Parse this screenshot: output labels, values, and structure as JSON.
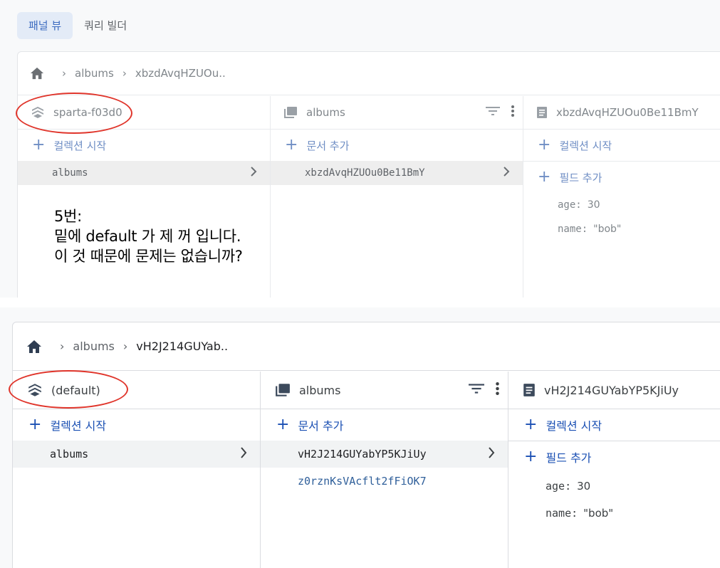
{
  "top": {
    "tabs": [
      {
        "label": "패널 뷰",
        "active": true
      },
      {
        "label": "쿼리 빌더",
        "active": false
      }
    ],
    "breadcrumb": {
      "root_icon": "home-icon",
      "items": [
        "albums",
        "xbzdAvqHZUOu.."
      ]
    },
    "columns": {
      "database": {
        "title": "sparta-f03d0",
        "action": "컬렉션 시작",
        "items": [
          "albums"
        ]
      },
      "collection": {
        "title": "albums",
        "action": "문서 추가",
        "items": [
          "xbzdAvqHZUOu0Be11BmY"
        ]
      },
      "document": {
        "title": "xbzdAvqHZUOu0Be11BmY",
        "action": "컬렉션 시작",
        "field_action": "필드 추가",
        "fields": [
          {
            "key": "age",
            "value": "30"
          },
          {
            "key": "name",
            "value": "\"bob\""
          }
        ]
      }
    }
  },
  "note": {
    "lines": [
      "5번:",
      "밑에 default 가 제 꺼 입니다.",
      "이 것 때문에 문제는 없습니까?"
    ]
  },
  "bottom": {
    "breadcrumb": {
      "root_icon": "home-icon",
      "items": [
        "albums",
        "vH2J214GUYab.."
      ]
    },
    "columns": {
      "database": {
        "title": "(default)",
        "action": "컬렉션 시작",
        "items": [
          "albums"
        ]
      },
      "collection": {
        "title": "albums",
        "action": "문서 추가",
        "items": [
          "vH2J214GUYabYP5KJiUy",
          "z0rznKsVAcflt2fFiOK7"
        ]
      },
      "document": {
        "title": "vH2J214GUYabYP5KJiUy",
        "action": "컬렉션 시작",
        "field_action": "필드 추가",
        "fields": [
          {
            "key": "age",
            "value": "30"
          },
          {
            "key": "name",
            "value": "\"bob\""
          }
        ]
      }
    }
  },
  "colors": {
    "annotation_ring": "#e0352b",
    "accent": "#1a4fb3",
    "active_tab_bg": "#e3ebf7"
  }
}
